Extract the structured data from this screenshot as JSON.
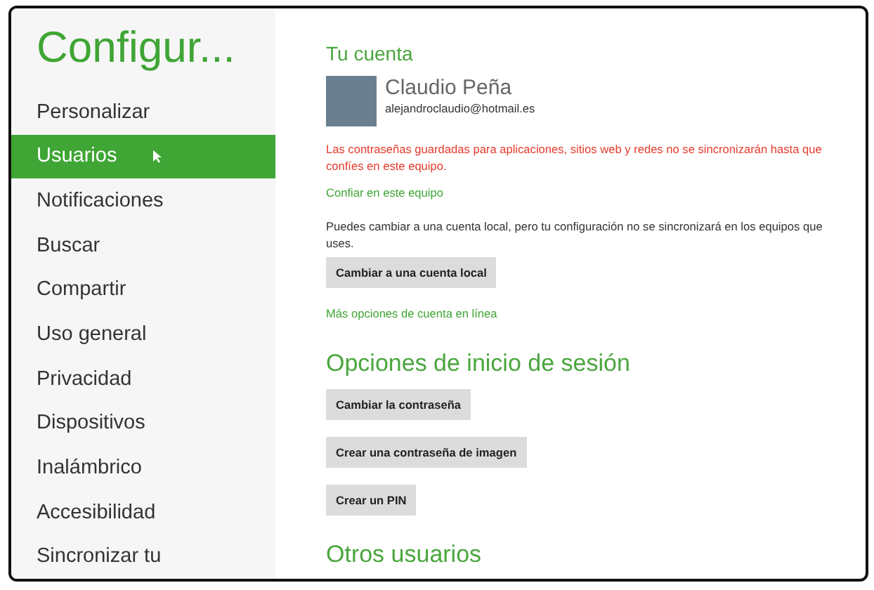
{
  "sidebar": {
    "title": "Configur...",
    "items": [
      {
        "label": "Personalizar",
        "selected": false
      },
      {
        "label": "Usuarios",
        "selected": true
      },
      {
        "label": "Notificaciones",
        "selected": false
      },
      {
        "label": "Buscar",
        "selected": false
      },
      {
        "label": "Compartir",
        "selected": false
      },
      {
        "label": "Uso general",
        "selected": false
      },
      {
        "label": "Privacidad",
        "selected": false
      },
      {
        "label": "Dispositivos",
        "selected": false
      },
      {
        "label": "Inalámbrico",
        "selected": false
      },
      {
        "label": "Accesibilidad",
        "selected": false
      },
      {
        "label": "Sincronizar tu",
        "selected": false
      }
    ]
  },
  "account": {
    "heading": "Tu cuenta",
    "name": "Claudio Peña",
    "email": "alejandroclaudio@hotmail.es",
    "warning": "Las contraseñas guardadas para aplicaciones, sitios web y redes no se sincronizarán hasta que confíes en este equipo.",
    "trust_link": "Confiar en este equipo",
    "info": "Puedes cambiar a una cuenta local, pero tu configuración no se sincronizará en los equipos que uses.",
    "local_button": "Cambiar a una cuenta local",
    "more_link": "Más opciones de cuenta en línea"
  },
  "signin": {
    "heading": "Opciones de inicio de sesión",
    "buttons": [
      "Cambiar la contraseña",
      "Crear una contraseña de imagen",
      "Crear un PIN"
    ]
  },
  "others": {
    "heading": "Otros usuarios"
  }
}
